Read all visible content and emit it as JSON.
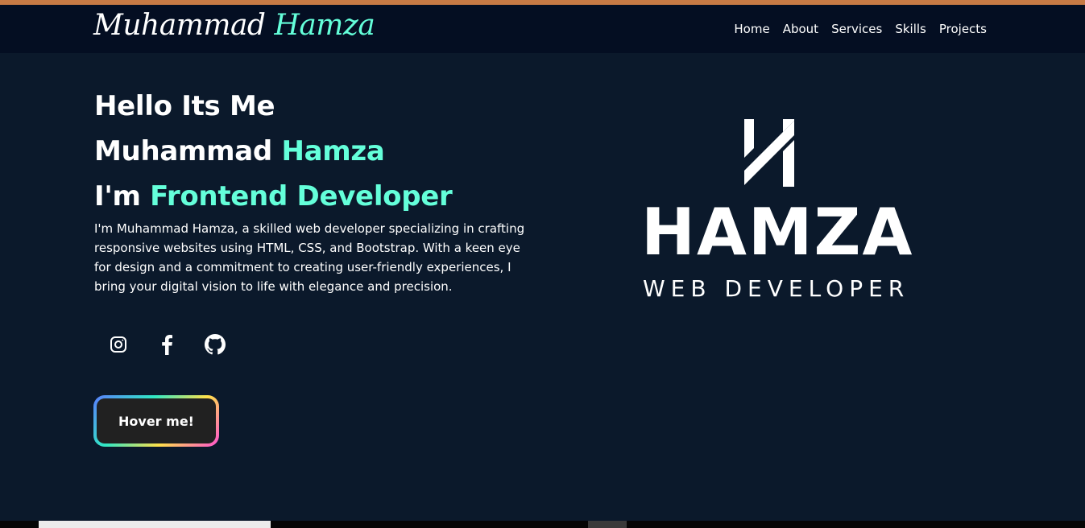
{
  "brand": {
    "first": "Muhammad",
    "last": "Hamza"
  },
  "nav": [
    "Home",
    "About",
    "Services",
    "Skills",
    "Projects"
  ],
  "hero": {
    "line1": "Hello Its Me",
    "line2_prefix": "Muhammad",
    "line2_accent": "Hamza",
    "line3_prefix": "I'm",
    "line3_accent": "Frontend Developer",
    "intro": "I'm Muhammad Hamza, a skilled web developer specializing in crafting responsive websites using HTML, CSS, and Bootstrap. With a keen eye for design and a commitment to creating user-friendly experiences, I bring your digital vision to life with elegance and precision."
  },
  "socials": [
    {
      "icon": "instagram-icon"
    },
    {
      "icon": "facebook-icon"
    },
    {
      "icon": "github-icon"
    }
  ],
  "button": {
    "label": "Hover me!"
  },
  "logo": {
    "name": "HAMZA",
    "subtitle": "WEB DEVELOPER"
  },
  "colors": {
    "background": "#0b192b",
    "navbar": "#040e22",
    "accent": "#64ffda",
    "top_strip": "#c77a45",
    "button_bg": "#212121"
  }
}
